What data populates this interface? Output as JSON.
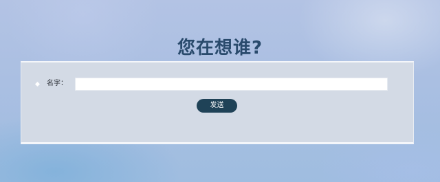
{
  "page": {
    "title": "您在想谁?"
  },
  "form": {
    "name_label": "名字：",
    "name_value": "",
    "name_placeholder": "",
    "submit_label": "发送"
  },
  "colors": {
    "title": "#294a6c",
    "panel_bg": "#d3dae5",
    "button_bg": "#1f4257",
    "button_text": "#ffffff"
  },
  "icons": {
    "bullet": "diamond-bullet-icon"
  }
}
